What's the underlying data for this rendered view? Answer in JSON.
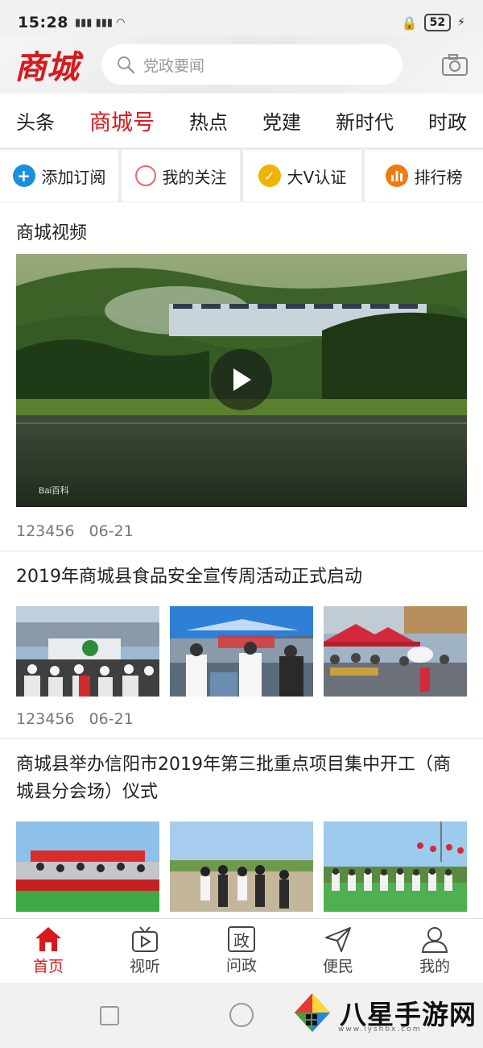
{
  "status_bar": {
    "time": "15:28",
    "signal": "3G 4G",
    "battery": "52"
  },
  "header": {
    "logo": "商城",
    "search_placeholder": "党政要闻"
  },
  "tabs": [
    "头条",
    "商城号",
    "热点",
    "党建",
    "新时代",
    "时政"
  ],
  "active_tab": 1,
  "sub_tabs": [
    {
      "label": "添加订阅",
      "icon": "plus-circle-icon"
    },
    {
      "label": "我的关注",
      "icon": "ring-icon"
    },
    {
      "label": "大V认证",
      "icon": "v-badge-icon"
    },
    {
      "label": "排行榜",
      "icon": "chart-icon"
    }
  ],
  "video_section": {
    "title": "商城视频",
    "watermark": "Bai百科",
    "views": "123456",
    "date": "06-21"
  },
  "articles": [
    {
      "title": "2019年商城县食品安全宣传周活动正式启动",
      "views": "123456",
      "date": "06-21"
    },
    {
      "title": "商城县举办信阳市2019年第三批重点项目集中开工（商城县分会场）仪式"
    }
  ],
  "bottom_nav": [
    {
      "label": "首页",
      "icon": "home-icon"
    },
    {
      "label": "视听",
      "icon": "tv-play-icon"
    },
    {
      "label": "问政",
      "icon": "zheng-box-icon",
      "glyph": "政"
    },
    {
      "label": "便民",
      "icon": "send-icon"
    },
    {
      "label": "我的",
      "icon": "user-icon"
    }
  ],
  "watermark": {
    "brand": "八星手游网",
    "url": "www.lyshbx.com"
  },
  "colors": {
    "accent": "#d8191c",
    "blue": "#1b8fde",
    "gold": "#f0b400",
    "orange": "#f27a12"
  }
}
